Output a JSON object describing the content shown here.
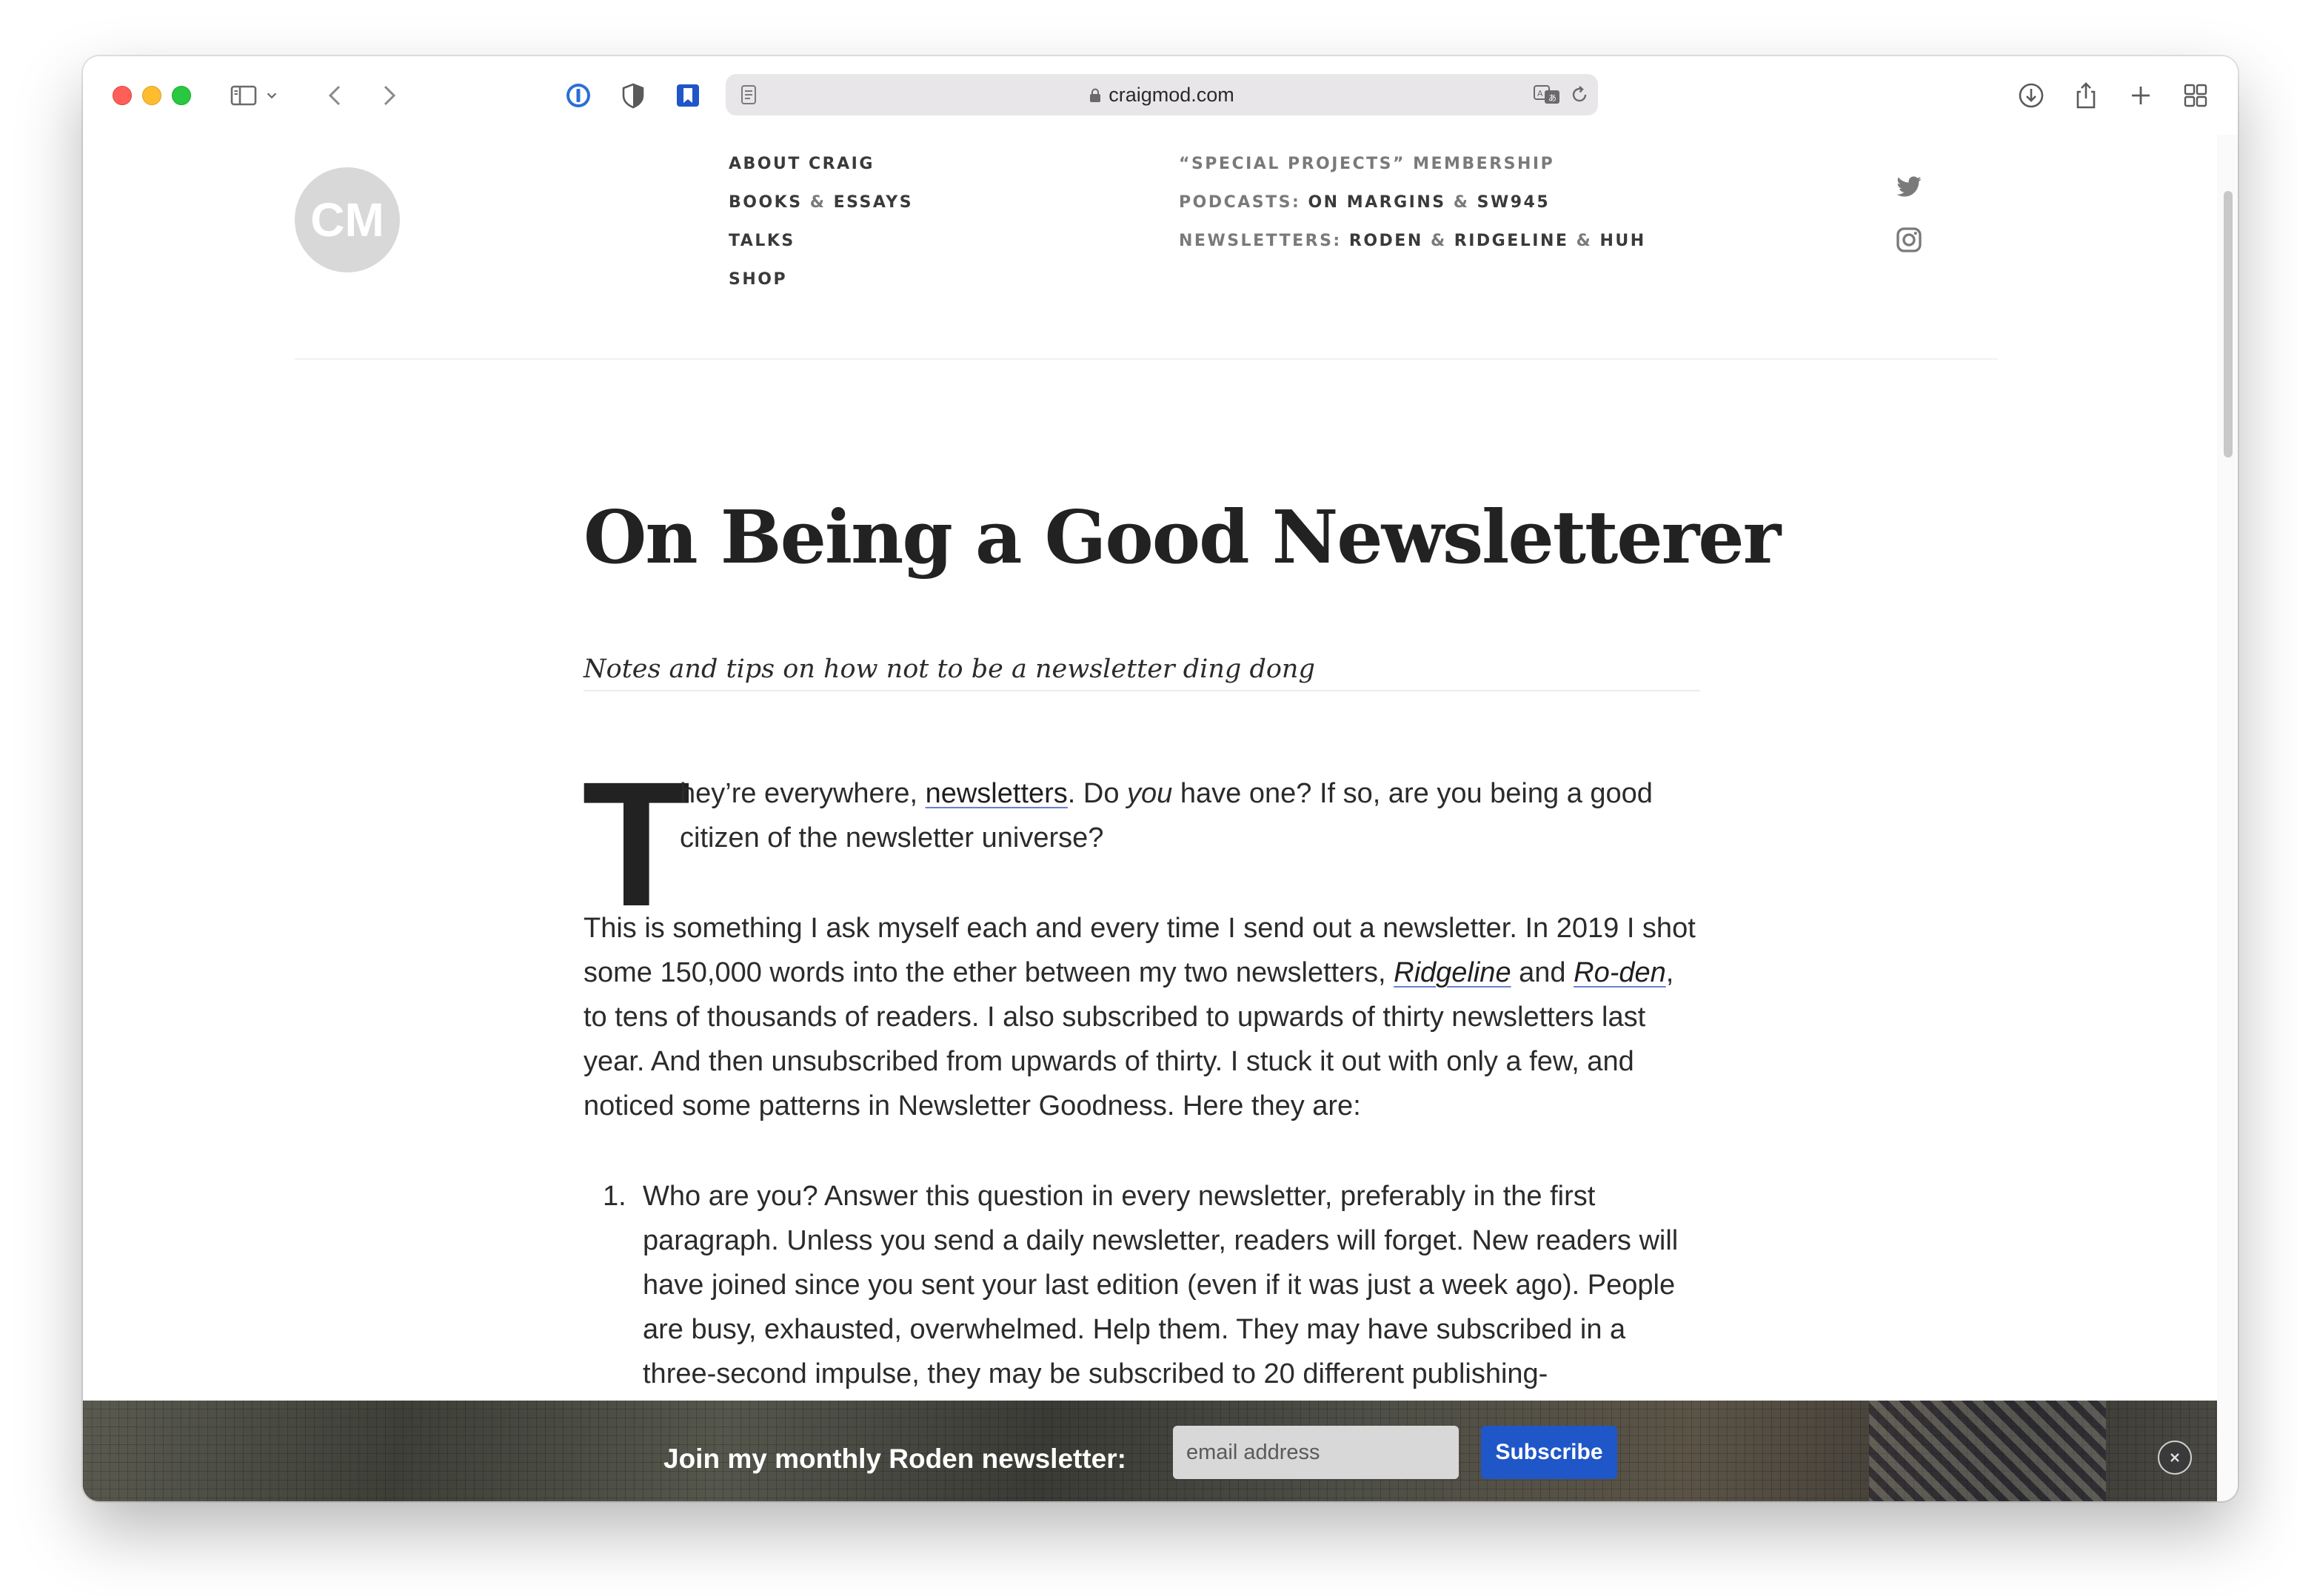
{
  "browser": {
    "url": "craigmod.com",
    "traffic_lights": [
      "close",
      "minimize",
      "zoom"
    ],
    "toolbar_icons": [
      "sidebar-icon",
      "chevron-down-icon",
      "back-icon",
      "forward-icon",
      "password-manager-icon",
      "privacy-shield-icon",
      "bookmark-icon",
      "reader-page-icon",
      "lock-icon",
      "translate-icon",
      "reload-icon",
      "download-icon",
      "share-icon",
      "new-tab-icon",
      "tab-overview-icon"
    ]
  },
  "site": {
    "logo": "CM",
    "nav_left": [
      "ABOUT CRAIG",
      "BOOKS",
      "&",
      "ESSAYS",
      "TALKS",
      "SHOP"
    ],
    "nav_right": {
      "special": "“SPECIAL PROJECTS” MEMBERSHIP",
      "podcasts_label": "PODCASTS:",
      "podcast_1": "ON MARGINS",
      "amp": "&",
      "podcast_2": "SW945",
      "newsletters_label": "NEWSLETTERS:",
      "newsletter_1": "RODEN",
      "newsletter_2": "RIDGELINE",
      "newsletter_3": "HUH"
    },
    "social": [
      "twitter-icon",
      "instagram-icon"
    ]
  },
  "article": {
    "title": "On Being a Good Newsletterer",
    "subtitle": "Notes and tips on how not to be a newsletter ding dong",
    "dropcap": "T",
    "p1_a": "hey’re everywhere, ",
    "p1_link": "newsletters",
    "p1_b": ". Do ",
    "p1_em": "you",
    "p1_c": " have one? If so, are you being a good citizen of the newsletter universe?",
    "p2_a": "This is something I ask myself each and every time I send out a newsletter. In 2019 I shot some 150,000 words into the ether between my two newsletters, ",
    "p2_link1": "Ridgeline",
    "p2_b": " and ",
    "p2_link2": "Ro-den",
    "p2_c": ", to tens of thousands of readers. I also subscribed to upwards of thirty newsletters last year. And then unsubscribed from upwards of thirty. I stuck it out with only a few, and noticed some patterns in Newsletter Goodness. Here they are:",
    "list_num": "1.",
    "list_1": "Who are you? Answer this question in every newsletter, preferably in the first paragraph. Unless you send a daily newsletter, readers will forget. New readers will have joined since you sent your last edition (even if it was just a week ago). People are busy, exhausted, overwhelmed. Help them. They may have subscribed in a three-second impulse, they may be subscribed to 20 different publishing-"
  },
  "newsletter_bar": {
    "label": "Join my monthly Roden newsletter:",
    "placeholder": "email address",
    "button": "Subscribe"
  }
}
